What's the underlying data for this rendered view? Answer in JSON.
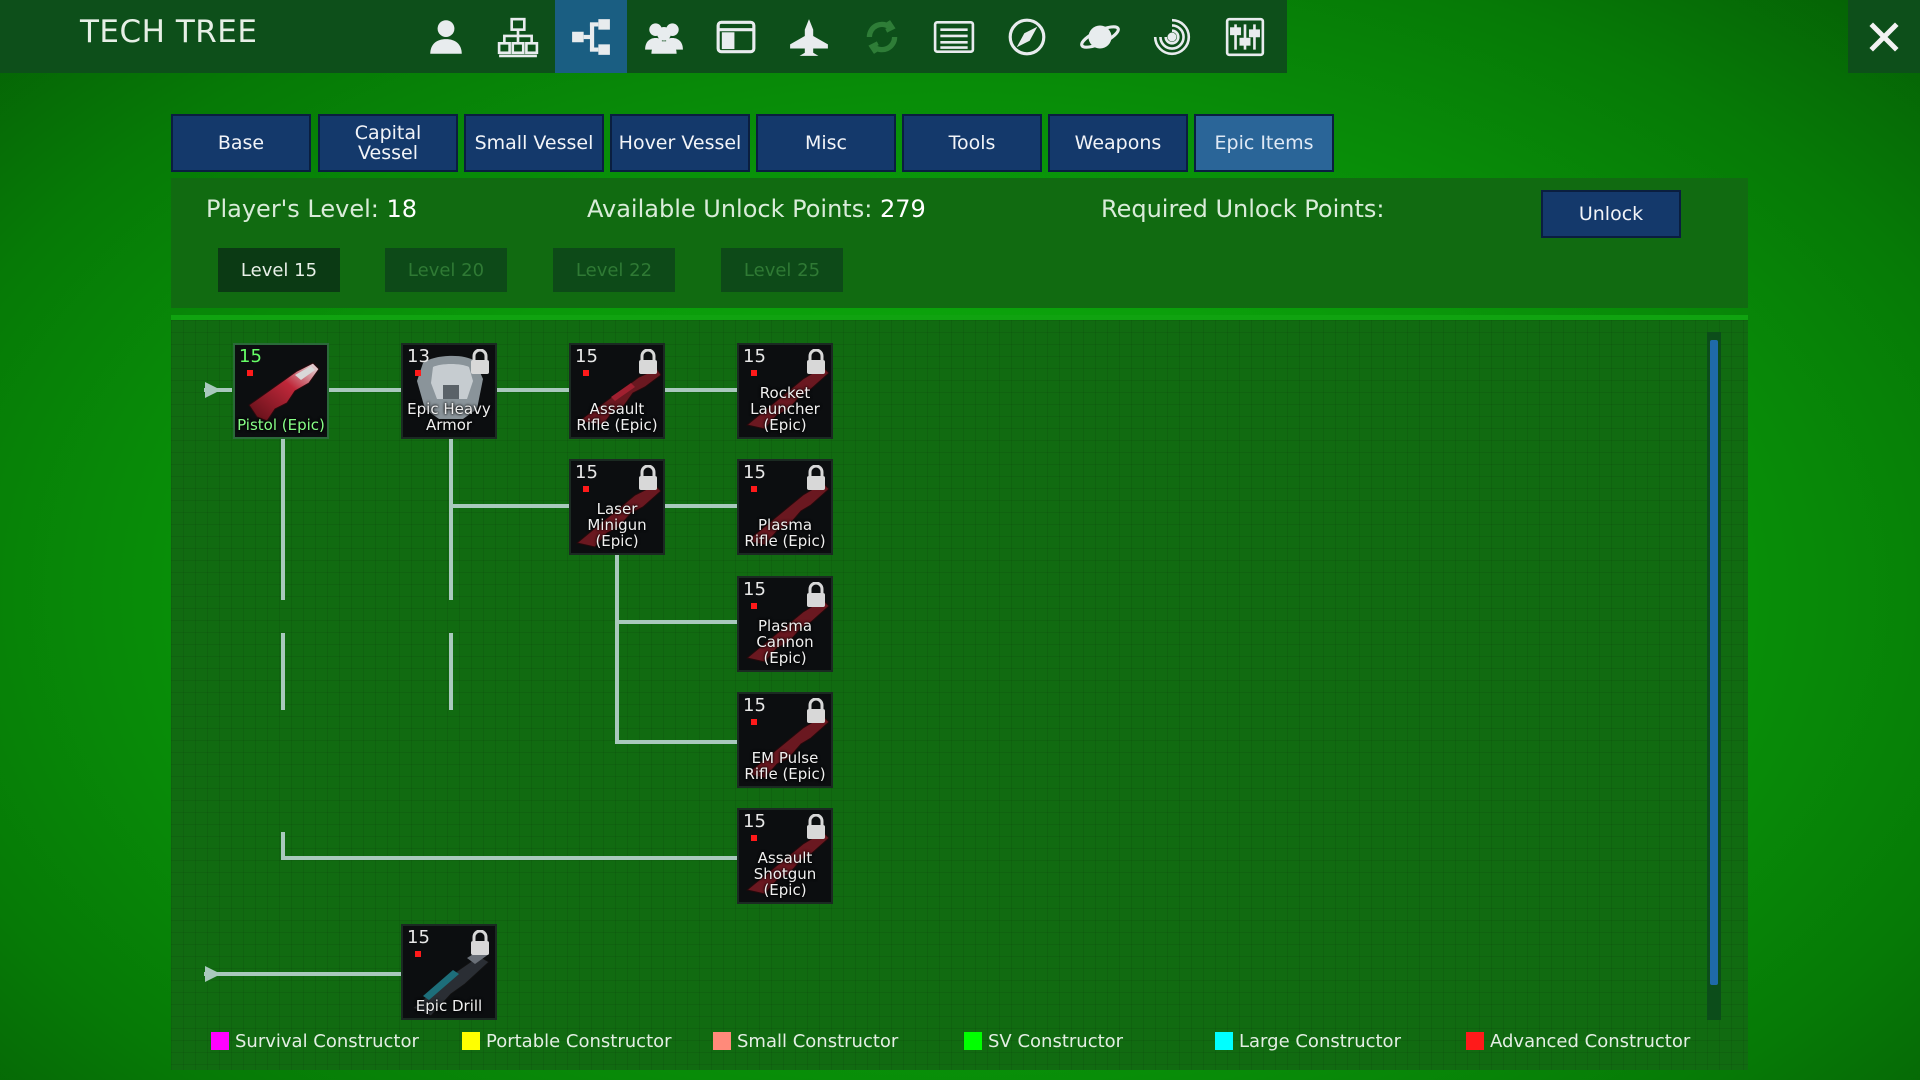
{
  "window": {
    "title": "TECH TREE"
  },
  "nav_icons": [
    {
      "name": "player-icon"
    },
    {
      "name": "factions-icon"
    },
    {
      "name": "tech-tree-icon",
      "active": true
    },
    {
      "name": "group-icon"
    },
    {
      "name": "registry-icon"
    },
    {
      "name": "ship-icon"
    },
    {
      "name": "trade-icon"
    },
    {
      "name": "log-icon"
    },
    {
      "name": "compass-icon"
    },
    {
      "name": "planet-icon"
    },
    {
      "name": "galaxy-icon"
    },
    {
      "name": "settings-icon"
    },
    {
      "name": "close-icon"
    }
  ],
  "tabs": [
    {
      "label": "Base"
    },
    {
      "label": "Capital Vessel"
    },
    {
      "label": "Small Vessel"
    },
    {
      "label": "Hover Vessel"
    },
    {
      "label": "Misc"
    },
    {
      "label": "Tools"
    },
    {
      "label": "Weapons"
    },
    {
      "label": "Epic Items",
      "active": true
    }
  ],
  "info": {
    "player_level_label": "Player's Level:",
    "player_level": "18",
    "available_label": "Available Unlock Points:",
    "available": "279",
    "required_label": "Required Unlock Points:",
    "unlock_button": "Unlock"
  },
  "level_tabs": [
    {
      "label": "Level 15",
      "active": true
    },
    {
      "label": "Level 20"
    },
    {
      "label": "Level 22"
    },
    {
      "label": "Level 25"
    }
  ],
  "nodes": [
    {
      "level": "15",
      "name": "Pistol (Epic)",
      "locked": false
    },
    {
      "level": "13",
      "name": "Epic Heavy Armor",
      "locked": true
    },
    {
      "level": "15",
      "name": "Assault Rifle (Epic)",
      "locked": true
    },
    {
      "level": "15",
      "name": "Rocket Launcher (Epic)",
      "locked": true
    },
    {
      "level": "15",
      "name": "Laser Minigun (Epic)",
      "locked": true
    },
    {
      "level": "15",
      "name": "Plasma Rifle (Epic)",
      "locked": true
    },
    {
      "level": "15",
      "name": "Plasma Cannon (Epic)",
      "locked": true
    },
    {
      "level": "15",
      "name": "EM Pulse Rifle (Epic)",
      "locked": true
    },
    {
      "level": "15",
      "name": "Assault Shotgun (Epic)",
      "locked": true
    },
    {
      "level": "15",
      "name": "Epic Drill",
      "locked": true
    }
  ],
  "legend": [
    {
      "label": "Survival Constructor",
      "color": "#ff00ff"
    },
    {
      "label": "Portable Constructor",
      "color": "#ffff00"
    },
    {
      "label": "Small Constructor",
      "color": "#ff8a7a"
    },
    {
      "label": "SV Constructor",
      "color": "#00ff00"
    },
    {
      "label": "Large Constructor",
      "color": "#00ffff"
    },
    {
      "label": "Advanced Constructor",
      "color": "#ff1a1a"
    }
  ],
  "colors": {
    "tab_bg": "#14396b",
    "tab_active": "#2a6598",
    "nav_active": "#1a5e82",
    "background": "#0a9a0a"
  }
}
